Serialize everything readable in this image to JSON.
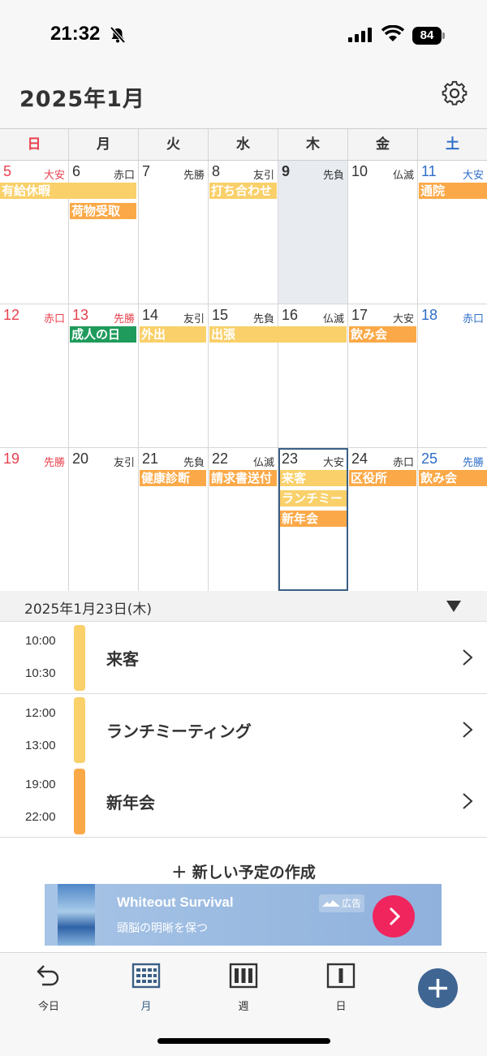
{
  "status_bar": {
    "time": "21:32",
    "battery": "84"
  },
  "header": {
    "title": "2025年1月"
  },
  "weekdays": [
    "日",
    "月",
    "火",
    "水",
    "木",
    "金",
    "土"
  ],
  "weeks": [
    {
      "days": [
        {
          "num": "5",
          "rokuyo": "大安"
        },
        {
          "num": "6",
          "rokuyo": "赤口"
        },
        {
          "num": "7",
          "rokuyo": "先勝"
        },
        {
          "num": "8",
          "rokuyo": "友引"
        },
        {
          "num": "9",
          "rokuyo": "先負"
        },
        {
          "num": "10",
          "rokuyo": "仏滅"
        },
        {
          "num": "11",
          "rokuyo": "大安"
        }
      ],
      "events": [
        "有給休暇",
        "荷物受取",
        "打ち合わせ",
        "通院"
      ]
    },
    {
      "days": [
        {
          "num": "12",
          "rokuyo": "赤口"
        },
        {
          "num": "13",
          "rokuyo": "先勝"
        },
        {
          "num": "14",
          "rokuyo": "友引"
        },
        {
          "num": "15",
          "rokuyo": "先負"
        },
        {
          "num": "16",
          "rokuyo": "仏滅"
        },
        {
          "num": "17",
          "rokuyo": "大安"
        },
        {
          "num": "18",
          "rokuyo": "赤口"
        }
      ],
      "events": [
        "成人の日",
        "外出",
        "出張",
        "飲み会"
      ]
    },
    {
      "days": [
        {
          "num": "19",
          "rokuyo": "先勝"
        },
        {
          "num": "20",
          "rokuyo": "友引"
        },
        {
          "num": "21",
          "rokuyo": "先負"
        },
        {
          "num": "22",
          "rokuyo": "仏滅"
        },
        {
          "num": "23",
          "rokuyo": "大安"
        },
        {
          "num": "24",
          "rokuyo": "赤口"
        },
        {
          "num": "25",
          "rokuyo": "先勝"
        }
      ],
      "events": [
        "健康診断",
        "請求書送付",
        "来客",
        "ランチミー",
        "新年会",
        "区役所",
        "飲み会"
      ]
    }
  ],
  "detail": {
    "date": "2025年1月23日(木)",
    "items": [
      {
        "start": "10:00",
        "end": "10:30",
        "title": "来客",
        "color": "#f9d06a"
      },
      {
        "start": "12:00",
        "end": "13:00",
        "title": "ランチミーティング",
        "color": "#f9d06a"
      },
      {
        "start": "19:00",
        "end": "22:00",
        "title": "新年会",
        "color": "#fba948"
      }
    ],
    "new_event_label": "＋ 新しい予定の作成"
  },
  "ad": {
    "title": "Whiteout Survival",
    "subtitle": "頭脳の明晰を保つ",
    "badge": "広告"
  },
  "nav": {
    "today": "今日",
    "month": "月",
    "week": "週",
    "day": "日"
  },
  "colors": {
    "accent": "#3a5f86",
    "sunday": "#e8424f",
    "saturday": "#2e6ec8",
    "event_yellow": "#f9d06a",
    "event_orange": "#fba948",
    "event_green": "#1f9b5c",
    "ad_button": "#f0255d"
  }
}
